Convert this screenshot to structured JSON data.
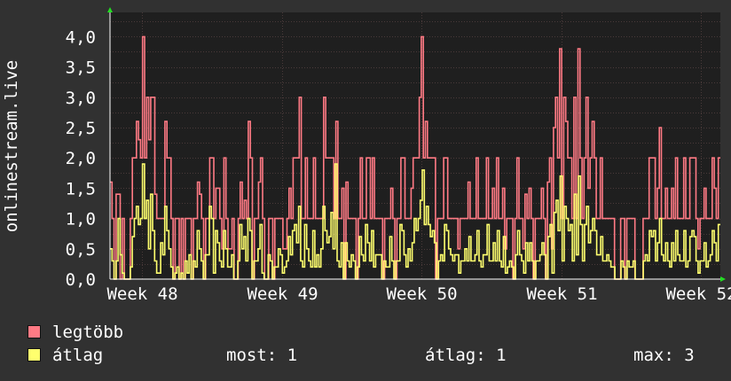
{
  "colors": {
    "background": "#313131",
    "plot_background": "#1f1f1f",
    "grid": "#4a3a3a",
    "text": "#ffffff",
    "max_series": "#ff7a84",
    "avg_series": "#ffff6e",
    "axis_arrow": "#22dd22"
  },
  "chart_data": {
    "type": "line",
    "xlabel": "",
    "ylabel": "onlinestream.live",
    "ylim": [
      0,
      4.4
    ],
    "y_ticks": [
      "0,0",
      "0,5",
      "1,0",
      "1,5",
      "2,0",
      "2,5",
      "3,0",
      "3,5",
      "4,0"
    ],
    "x_ticks": [
      "Week 48",
      "Week 49",
      "Week 50",
      "Week 51",
      "Week 52"
    ],
    "grid": true,
    "legend_placement": "bottom-left",
    "series": [
      {
        "name": "legtöbb",
        "color": "#ff7a84",
        "values": [
          1.6,
          1,
          0,
          1.4,
          1.4,
          0,
          1,
          0,
          0,
          0,
          1,
          2,
          2,
          2.6,
          2.3,
          2,
          4,
          2,
          3,
          2.3,
          3,
          3,
          1.4,
          1,
          1,
          1,
          1,
          2.6,
          2,
          2,
          1,
          0,
          1,
          1,
          0,
          1,
          0,
          1,
          1,
          1,
          0,
          1,
          1,
          1.6,
          1.4,
          1,
          0,
          1,
          1,
          2,
          2,
          1,
          1.5,
          1.5,
          1,
          0.5,
          2,
          1,
          0.5,
          0.5,
          1,
          0,
          0,
          1,
          1.6,
          1,
          1.3,
          1,
          2.6,
          2,
          0,
          1,
          1,
          1.6,
          2,
          1,
          0,
          0,
          1,
          1,
          0,
          1,
          1,
          1,
          1,
          0.5,
          0.5,
          1,
          1.5,
          1,
          2,
          2,
          2,
          3,
          1,
          1,
          2,
          1,
          1,
          1,
          2,
          1,
          1,
          1,
          1,
          3,
          2,
          2,
          2,
          2,
          1,
          2.6,
          1,
          1,
          1.5,
          0,
          1.6,
          1,
          1,
          1,
          1,
          0,
          1,
          2,
          1,
          1,
          2,
          2,
          1,
          2,
          1,
          1,
          1,
          1,
          0,
          1,
          1,
          1,
          1.5,
          1,
          0,
          1,
          1,
          2,
          2,
          1,
          1,
          1,
          1.5,
          2,
          2,
          2,
          3,
          4,
          2,
          2.6,
          2,
          2,
          2,
          2,
          0,
          1,
          1,
          1,
          2,
          2,
          1,
          1,
          1,
          1,
          1,
          0.5,
          1,
          1,
          1,
          1,
          1.6,
          1,
          1,
          1,
          2,
          1,
          1,
          1,
          1,
          2,
          1,
          1,
          1.5,
          1,
          2,
          1,
          1,
          1.5,
          0.5,
          1,
          1,
          1,
          0,
          1,
          2,
          1,
          1,
          0.5,
          1.4,
          1,
          1.5,
          1,
          0,
          1,
          1,
          1,
          1.5,
          1,
          0,
          1.6,
          2,
          0.5,
          2.5,
          3,
          2,
          3.8,
          1,
          3,
          2.6,
          2,
          2,
          1,
          3,
          1,
          3.8,
          2,
          1,
          2,
          3,
          1.5,
          2,
          2.6,
          2,
          1,
          1,
          2,
          1,
          1,
          1,
          1,
          1,
          1,
          0,
          0,
          0,
          1,
          1,
          0,
          1,
          1,
          1,
          1,
          0,
          0,
          0,
          0,
          1,
          1,
          1,
          2,
          2,
          2,
          1,
          1.5,
          2.5,
          1,
          1,
          1.5,
          1,
          1,
          1.5,
          1,
          2,
          1,
          1,
          1,
          2,
          1,
          1,
          2,
          2,
          2,
          1,
          0.5,
          1,
          1,
          1.5,
          1,
          1,
          1,
          2,
          1.5,
          1,
          2
        ]
      },
      {
        "name": "átlag",
        "color": "#ffff6e",
        "values": [
          0.5,
          0.3,
          0,
          0.3,
          1,
          0.4,
          0.1,
          0,
          0,
          0,
          0.2,
          0.7,
          1,
          1.2,
          0.9,
          1,
          1.9,
          1,
          1.3,
          0.5,
          1.4,
          0.8,
          0.3,
          0.1,
          0.1,
          0.6,
          0.4,
          1.2,
          0.8,
          0.5,
          0.2,
          0,
          0.1,
          0.2,
          0,
          0.1,
          0,
          0.3,
          0.1,
          0.4,
          0,
          0.3,
          0.2,
          0.8,
          0.5,
          0.3,
          0,
          0.4,
          0.4,
          1.2,
          1,
          0.1,
          0.8,
          0.6,
          0.3,
          0.2,
          0.8,
          0.5,
          0.2,
          0.2,
          0.4,
          0,
          0,
          0.3,
          0.9,
          0.5,
          0.7,
          0.3,
          1,
          0.8,
          0,
          0.3,
          0.3,
          0.5,
          0.9,
          0.1,
          0,
          0,
          0.4,
          0.3,
          0,
          0.2,
          0.2,
          0.5,
          0.4,
          0.1,
          0.2,
          0.3,
          0.7,
          0.4,
          0.8,
          0.9,
          0.6,
          1.2,
          0.3,
          0.2,
          0.9,
          0.5,
          0.3,
          0.2,
          0.8,
          0.2,
          0.4,
          0.2,
          0.5,
          1.2,
          0.8,
          0.6,
          0.7,
          1.1,
          0.5,
          1.9,
          0.3,
          0.2,
          0.6,
          0,
          0.6,
          0.3,
          0.2,
          0.4,
          0.3,
          0,
          0.2,
          0.7,
          0.4,
          0.3,
          0.9,
          0.6,
          0.3,
          0.8,
          0.2,
          0.4,
          0.4,
          0.4,
          0,
          0.3,
          0.2,
          0.2,
          0.7,
          0.3,
          0,
          0.3,
          0.3,
          0.9,
          0.8,
          0.4,
          0.2,
          0.5,
          0.3,
          0.6,
          1,
          0.8,
          1,
          1.3,
          1.8,
          0.9,
          1.2,
          0.9,
          0.7,
          0.8,
          0.6,
          0,
          0.3,
          0.4,
          0.3,
          0.9,
          0.8,
          0.5,
          0.4,
          0.3,
          0.4,
          0.4,
          0.1,
          0.3,
          0.3,
          0.5,
          0.3,
          0.7,
          0.3,
          0.3,
          0.4,
          0.8,
          0.3,
          0.2,
          0.4,
          0.4,
          0.9,
          0.3,
          0.3,
          0.6,
          0.3,
          0.8,
          0.3,
          0.2,
          0.7,
          0.1,
          0.2,
          0.3,
          0.2,
          0,
          0.4,
          0.8,
          0.4,
          0.3,
          0.1,
          0.6,
          0.3,
          0.6,
          0.3,
          0,
          0.3,
          0.3,
          0.4,
          0.6,
          0.4,
          0,
          0.7,
          0.9,
          0.1,
          1.1,
          1.3,
          0.8,
          1.7,
          0.3,
          1.2,
          1,
          0.8,
          0.9,
          0.3,
          1.4,
          0.4,
          1.7,
          0.9,
          0.3,
          0.9,
          1.2,
          0.6,
          0.8,
          1,
          0.8,
          0.4,
          0.4,
          0.7,
          0.3,
          0.3,
          0.4,
          0.3,
          0.2,
          0.2,
          0,
          0,
          0,
          0.3,
          0.2,
          0,
          0.3,
          0.2,
          0.2,
          0.3,
          0,
          0,
          0,
          0,
          0.3,
          0.4,
          0.3,
          0.8,
          0.7,
          0.8,
          0.3,
          0.6,
          1,
          0.4,
          0.3,
          0.6,
          0.3,
          0.2,
          0.6,
          0.3,
          0.8,
          0.4,
          0.3,
          0.3,
          0.8,
          0.2,
          0.3,
          0.7,
          0.8,
          0.7,
          0.3,
          0.1,
          0.3,
          0.3,
          0.6,
          0.2,
          0.3,
          0.4,
          0.8,
          0.6,
          0.3,
          0.9
        ]
      }
    ]
  },
  "legend": {
    "max_label": "legtöbb",
    "avg_label": "átlag",
    "stat_now": "most: 1",
    "stat_avg": "átlag: 1",
    "stat_max": "max: 3"
  }
}
